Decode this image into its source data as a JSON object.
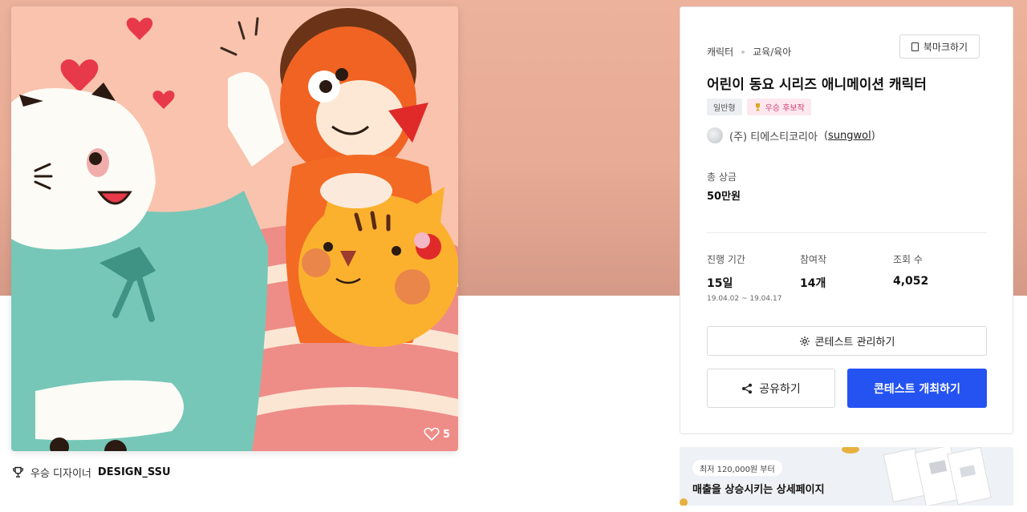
{
  "artwork": {
    "likes": "5"
  },
  "designer": {
    "prefix": "우승 디자이너",
    "name": "DESIGN_SSU"
  },
  "contest": {
    "category": "캐릭터",
    "subcategory": "교육/육아",
    "bookmark_label": "북마크하기",
    "title": "어린이 동요 시리즈 애니메이션 캐릭터",
    "badges": [
      "일반형",
      "우승 후보작"
    ],
    "host_name": "(주) 티에스티코리아",
    "host_id": "sungwol",
    "prize_label": "총 상금",
    "prize_value": "50만원",
    "stats": {
      "period_label": "진행 기간",
      "period_value": "15일",
      "period_dates": "19.04.02 ~ 19.04.17",
      "entries_label": "참여작",
      "entries_value": "14개",
      "views_label": "조회 수",
      "views_value": "4,052"
    },
    "manage_label": "콘테스트 관리하기",
    "share_label": "공유하기",
    "host_contest_label": "콘테스트 개최하기"
  },
  "ad": {
    "pill": "최저 120,000원 부터",
    "title": "매출을 상승시키는 상세페이지"
  },
  "colors": {
    "accent": "#2453f2",
    "hero": "#e8ab95",
    "badge_pink": "#d23f6e"
  }
}
